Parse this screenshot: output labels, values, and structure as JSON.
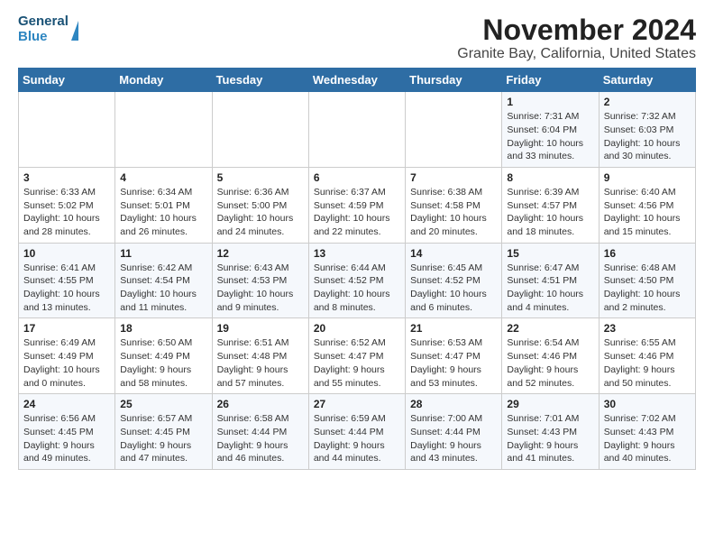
{
  "header": {
    "logo_line1": "General",
    "logo_line2": "Blue",
    "title": "November 2024",
    "subtitle": "Granite Bay, California, United States"
  },
  "days_of_week": [
    "Sunday",
    "Monday",
    "Tuesday",
    "Wednesday",
    "Thursday",
    "Friday",
    "Saturday"
  ],
  "weeks": [
    [
      {
        "day": "",
        "info": ""
      },
      {
        "day": "",
        "info": ""
      },
      {
        "day": "",
        "info": ""
      },
      {
        "day": "",
        "info": ""
      },
      {
        "day": "",
        "info": ""
      },
      {
        "day": "1",
        "info": "Sunrise: 7:31 AM\nSunset: 6:04 PM\nDaylight: 10 hours\nand 33 minutes."
      },
      {
        "day": "2",
        "info": "Sunrise: 7:32 AM\nSunset: 6:03 PM\nDaylight: 10 hours\nand 30 minutes."
      }
    ],
    [
      {
        "day": "3",
        "info": "Sunrise: 6:33 AM\nSunset: 5:02 PM\nDaylight: 10 hours\nand 28 minutes."
      },
      {
        "day": "4",
        "info": "Sunrise: 6:34 AM\nSunset: 5:01 PM\nDaylight: 10 hours\nand 26 minutes."
      },
      {
        "day": "5",
        "info": "Sunrise: 6:36 AM\nSunset: 5:00 PM\nDaylight: 10 hours\nand 24 minutes."
      },
      {
        "day": "6",
        "info": "Sunrise: 6:37 AM\nSunset: 4:59 PM\nDaylight: 10 hours\nand 22 minutes."
      },
      {
        "day": "7",
        "info": "Sunrise: 6:38 AM\nSunset: 4:58 PM\nDaylight: 10 hours\nand 20 minutes."
      },
      {
        "day": "8",
        "info": "Sunrise: 6:39 AM\nSunset: 4:57 PM\nDaylight: 10 hours\nand 18 minutes."
      },
      {
        "day": "9",
        "info": "Sunrise: 6:40 AM\nSunset: 4:56 PM\nDaylight: 10 hours\nand 15 minutes."
      }
    ],
    [
      {
        "day": "10",
        "info": "Sunrise: 6:41 AM\nSunset: 4:55 PM\nDaylight: 10 hours\nand 13 minutes."
      },
      {
        "day": "11",
        "info": "Sunrise: 6:42 AM\nSunset: 4:54 PM\nDaylight: 10 hours\nand 11 minutes."
      },
      {
        "day": "12",
        "info": "Sunrise: 6:43 AM\nSunset: 4:53 PM\nDaylight: 10 hours\nand 9 minutes."
      },
      {
        "day": "13",
        "info": "Sunrise: 6:44 AM\nSunset: 4:52 PM\nDaylight: 10 hours\nand 8 minutes."
      },
      {
        "day": "14",
        "info": "Sunrise: 6:45 AM\nSunset: 4:52 PM\nDaylight: 10 hours\nand 6 minutes."
      },
      {
        "day": "15",
        "info": "Sunrise: 6:47 AM\nSunset: 4:51 PM\nDaylight: 10 hours\nand 4 minutes."
      },
      {
        "day": "16",
        "info": "Sunrise: 6:48 AM\nSunset: 4:50 PM\nDaylight: 10 hours\nand 2 minutes."
      }
    ],
    [
      {
        "day": "17",
        "info": "Sunrise: 6:49 AM\nSunset: 4:49 PM\nDaylight: 10 hours\nand 0 minutes."
      },
      {
        "day": "18",
        "info": "Sunrise: 6:50 AM\nSunset: 4:49 PM\nDaylight: 9 hours\nand 58 minutes."
      },
      {
        "day": "19",
        "info": "Sunrise: 6:51 AM\nSunset: 4:48 PM\nDaylight: 9 hours\nand 57 minutes."
      },
      {
        "day": "20",
        "info": "Sunrise: 6:52 AM\nSunset: 4:47 PM\nDaylight: 9 hours\nand 55 minutes."
      },
      {
        "day": "21",
        "info": "Sunrise: 6:53 AM\nSunset: 4:47 PM\nDaylight: 9 hours\nand 53 minutes."
      },
      {
        "day": "22",
        "info": "Sunrise: 6:54 AM\nSunset: 4:46 PM\nDaylight: 9 hours\nand 52 minutes."
      },
      {
        "day": "23",
        "info": "Sunrise: 6:55 AM\nSunset: 4:46 PM\nDaylight: 9 hours\nand 50 minutes."
      }
    ],
    [
      {
        "day": "24",
        "info": "Sunrise: 6:56 AM\nSunset: 4:45 PM\nDaylight: 9 hours\nand 49 minutes."
      },
      {
        "day": "25",
        "info": "Sunrise: 6:57 AM\nSunset: 4:45 PM\nDaylight: 9 hours\nand 47 minutes."
      },
      {
        "day": "26",
        "info": "Sunrise: 6:58 AM\nSunset: 4:44 PM\nDaylight: 9 hours\nand 46 minutes."
      },
      {
        "day": "27",
        "info": "Sunrise: 6:59 AM\nSunset: 4:44 PM\nDaylight: 9 hours\nand 44 minutes."
      },
      {
        "day": "28",
        "info": "Sunrise: 7:00 AM\nSunset: 4:44 PM\nDaylight: 9 hours\nand 43 minutes."
      },
      {
        "day": "29",
        "info": "Sunrise: 7:01 AM\nSunset: 4:43 PM\nDaylight: 9 hours\nand 41 minutes."
      },
      {
        "day": "30",
        "info": "Sunrise: 7:02 AM\nSunset: 4:43 PM\nDaylight: 9 hours\nand 40 minutes."
      }
    ]
  ]
}
